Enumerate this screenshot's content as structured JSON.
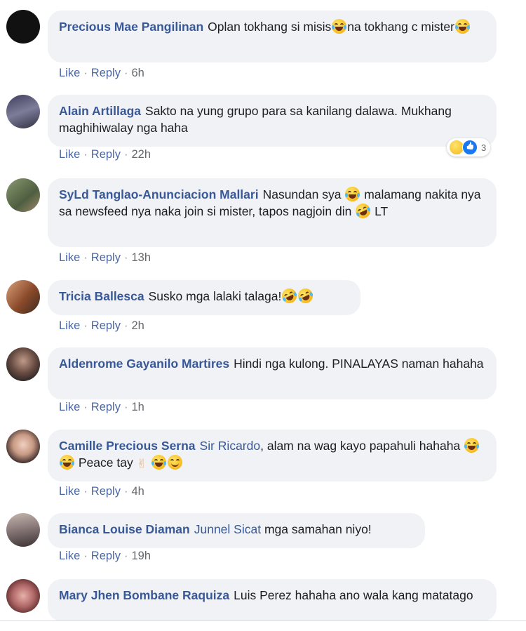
{
  "comments": [
    {
      "author": "Precious Mae Pangilinan",
      "parts": [
        "Oplan tokhang si misis",
        "na tokhang c mister",
        ""
      ],
      "like": "Like",
      "reply": "Reply",
      "time": "6h",
      "avatar_color": "#111111"
    },
    {
      "author": "Alain Artillaga",
      "text": "Sakto na yung grupo para sa kanilang dalawa. Mukhang maghihiwalay nga haha",
      "like": "Like",
      "reply": "Reply",
      "time": "22h",
      "reactions": {
        "count": "3",
        "types": [
          "haha-icon",
          "like-icon"
        ]
      },
      "avatar_color": "#4a4a6a"
    },
    {
      "author": "SyLd Tanglao-Anunciacion Mallari",
      "parts": [
        "Nasundan sya ",
        " malamang nakita nya sa newsfeed nya naka join si mister, tapos nagjoin din ",
        " LT"
      ],
      "like": "Like",
      "reply": "Reply",
      "time": "13h",
      "avatar_color": "#6b7a5c"
    },
    {
      "author": "Tricia Ballesca",
      "text": "Susko mga lalaki talaga!",
      "like": "Like",
      "reply": "Reply",
      "time": "2h",
      "avatar_color": "#a0674a"
    },
    {
      "author": "Aldenrome Gayanilo Martires",
      "text": "Hindi nga kulong. PINALAYAS naman hahaha",
      "like": "Like",
      "reply": "Reply",
      "time": "1h",
      "avatar_color": "#5a4a44"
    },
    {
      "author": "Camille Precious Serna",
      "mention": "Sir Ricardo",
      "parts": [
        ", alam na wag kayo papahuli hahaha ",
        " Peace tay ",
        ""
      ],
      "like": "Like",
      "reply": "Reply",
      "time": "4h",
      "avatar_color": "#c9a594"
    },
    {
      "author": "Bianca Louise Diaman",
      "mention": "Junnel Sicat",
      "text": " mga samahan niyo!",
      "like": "Like",
      "reply": "Reply",
      "time": "19h",
      "avatar_color": "#7a6a6a"
    },
    {
      "author": "Mary Jhen Bombane Raquiza",
      "text": "Luis Perez hahaha ano wala kang matatago",
      "avatar_color": "#b07070"
    }
  ],
  "icons": {
    "haha": "laughing-face-icon",
    "rofl": "rolling-on-floor-laughing-icon",
    "smile": "smiling-face-icon",
    "peace": "victory-hand-icon"
  },
  "colors": {
    "name_link": "#385898",
    "bubble": "#f0f2f5",
    "meta": "#65676b"
  }
}
